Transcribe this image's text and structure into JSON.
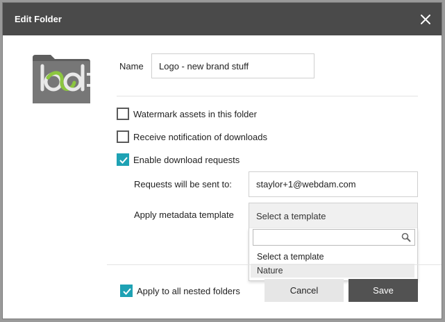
{
  "dialog": {
    "title": "Edit Folder"
  },
  "folder": {
    "logo_text": "bd"
  },
  "name_field": {
    "label": "Name",
    "value": "Logo - new brand stuff"
  },
  "options": {
    "watermark": {
      "label": "Watermark assets in this folder",
      "checked": false
    },
    "notify": {
      "label": "Receive notification of downloads",
      "checked": false
    },
    "download_requests": {
      "label": "Enable download requests",
      "checked": true
    }
  },
  "requests": {
    "label": "Requests will be sent to:",
    "value": "staylor+1@webdam.com"
  },
  "metadata": {
    "label": "Apply metadata template",
    "selected": "Select a template",
    "search_value": "",
    "options": [
      "Select a template",
      "Nature"
    ]
  },
  "footer": {
    "nested_label": "Apply to all nested folders",
    "nested_checked": true,
    "cancel_label": "Cancel",
    "save_label": "Save"
  },
  "colors": {
    "titlebar": "#4a4a4a",
    "accent": "#1ea2b4",
    "save_button": "#525252",
    "logo_green": "#8cc63f"
  },
  "icons": {
    "close": "close-icon",
    "folder": "folder-icon",
    "search": "search-icon",
    "check": "check-icon"
  }
}
